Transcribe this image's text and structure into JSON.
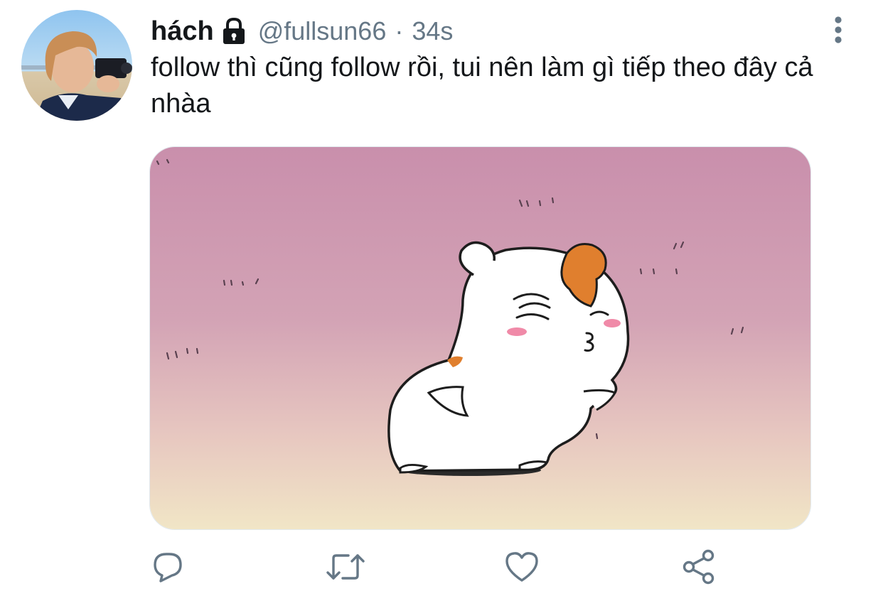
{
  "tweet": {
    "display_name": "hách",
    "handle": "@fullsun66",
    "separator": "·",
    "time": "34s",
    "text": "follow thì cũng follow rồi, tui nên làm gì tiếp theo đây cả nhàa"
  },
  "icons": {
    "lock": "lock-icon",
    "more": "more-vertical-icon",
    "reply": "reply-icon",
    "retweet": "retweet-icon",
    "like": "heart-icon",
    "share": "share-icon"
  },
  "colors": {
    "text_primary": "#14171a",
    "text_secondary": "#657786",
    "icon_gray": "#657786",
    "media_pink": "#c88fab",
    "media_cream": "#f2e6c9"
  }
}
